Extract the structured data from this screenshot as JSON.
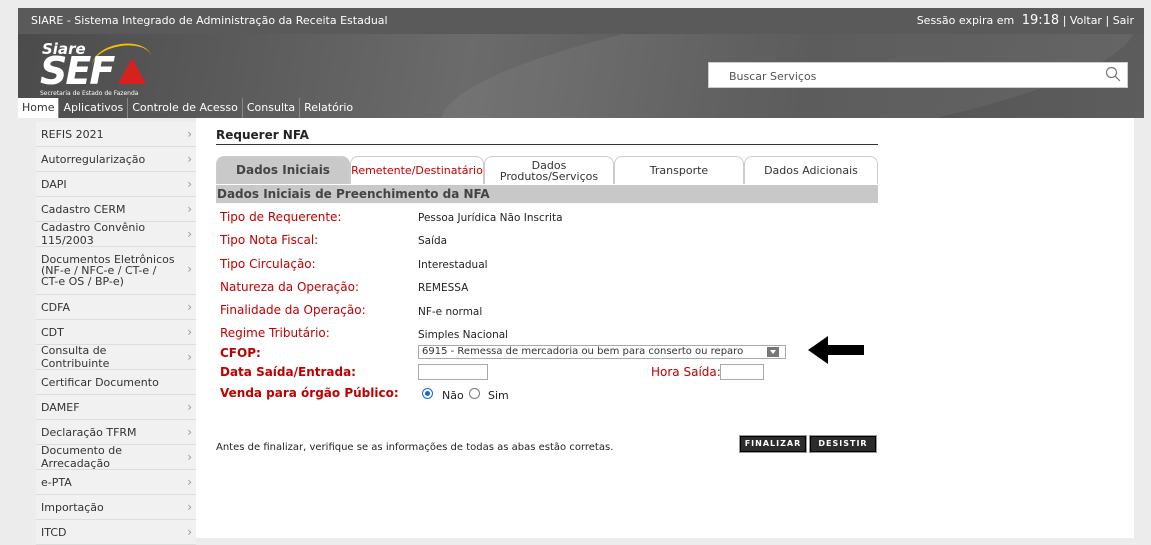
{
  "topbar": {
    "app_title": "SIARE - Sistema Integrado de Administração da Receita Estadual",
    "session_label": "Sessão expira em",
    "session_time": "19:18",
    "voltar": "Voltar",
    "sair": "Sair",
    "separator": "|"
  },
  "logo": {
    "siare": "Siare",
    "sef": "SEF",
    "subtitle": "Secretaria de Estado de Fazenda"
  },
  "search": {
    "placeholder": "Buscar Serviços"
  },
  "menu": [
    "Home",
    "Aplicativos",
    "Controle de Acesso",
    "Consulta",
    "Relatório"
  ],
  "sidebar": [
    "REFIS 2021",
    "Autorregularização",
    "DAPI",
    "Cadastro CERM",
    "Cadastro Convênio 115/2003",
    "Documentos Eletrônicos (NF-e / NFC-e / CT-e / CT-e OS / BP-e)",
    "CDFA",
    "CDT",
    "Consulta de Contribuinte",
    "Certificar Documento",
    "DAMEF",
    "Declaração TFRM",
    "Documento de Arrecadação",
    "e-PTA",
    "Importação",
    "ITCD"
  ],
  "page_title": "Requerer NFA",
  "tabs": [
    "Dados Iniciais",
    "Remetente/Destinatário",
    "Dados Produtos/Serviços",
    "Transporte",
    "Dados Adicionais"
  ],
  "section_title": "Dados Iniciais de Preenchimento da NFA",
  "fields": {
    "tipo_requerente": {
      "label": "Tipo de Requerente:",
      "value": "Pessoa Jurídica Não Inscrita"
    },
    "tipo_nota": {
      "label": "Tipo Nota Fiscal:",
      "value": "Saída"
    },
    "tipo_circulacao": {
      "label": "Tipo Circulação:",
      "value": "Interestadual"
    },
    "natureza": {
      "label": "Natureza da Operação:",
      "value": "REMESSA"
    },
    "finalidade": {
      "label": "Finalidade da Operação:",
      "value": "NF-e normal"
    },
    "regime": {
      "label": "Regime Tributário:",
      "value": "Simples Nacional"
    },
    "cfop": {
      "label": "CFOP:",
      "value": "6915 - Remessa de mercadoria ou bem para conserto ou reparo"
    },
    "data_saida": {
      "label": "Data Saída/Entrada:",
      "value": ""
    },
    "hora_saida": {
      "label": "Hora Saída:",
      "value": ""
    },
    "venda_publico": {
      "label": "Venda para órgão Público:",
      "option_nao": "Não",
      "option_sim": "Sim",
      "selected": "Não"
    }
  },
  "footnote": "Antes de finalizar, verifique se as informações de todas as abas estão corretas.",
  "buttons": {
    "finalizar": "FINALIZAR",
    "desistir": "DESISTIR"
  },
  "colors": {
    "label_red": "#c00000",
    "header_gray": "#c8c8c8",
    "topbar": "#5a5a5a"
  }
}
